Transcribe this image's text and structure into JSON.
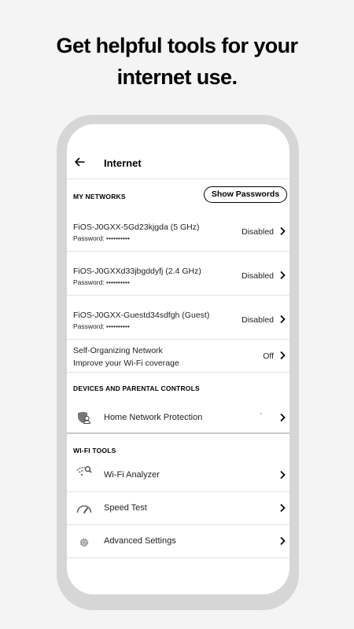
{
  "headline": {
    "line1": "Get helpful tools for your",
    "line2": "internet use."
  },
  "appbar": {
    "title": "Internet",
    "back_icon": "arrow-left-icon"
  },
  "my_networks": {
    "header": "MY NETWORKS",
    "show_passwords_label": "Show Passwords",
    "networks": [
      {
        "name": "FiOS-J0GXX-5Gd23kjgda (5 GHz)",
        "password": "Password: ••••••••••",
        "status": "Disabled"
      },
      {
        "name": "FiOS-J0GXXd33jbgddyfj (2.4 GHz)",
        "password": "Password: ••••••••••",
        "status": "Disabled"
      },
      {
        "name": "FiOS-J0GXX-Guestd34sdfgh (Guest)",
        "password": "Password: ••••••••••",
        "status": "Disabled"
      }
    ],
    "son": {
      "title": "Self-Organizing Network",
      "subtitle": "Improve your Wi-Fi coverage",
      "status": "Off"
    }
  },
  "devices": {
    "header": "DEVICES AND PARENTAL CONTROLS",
    "home_protection": {
      "label": "Home Network Protection",
      "tick": "ˋ",
      "icon": "shield-user-icon"
    }
  },
  "wifi_tools": {
    "header": "WI-FI TOOLS",
    "items": [
      {
        "label": "Wi-Fi Analyzer",
        "icon": "wifi-search-icon"
      },
      {
        "label": "Speed Test",
        "icon": "speedometer-icon"
      },
      {
        "label": "Advanced Settings",
        "icon": "gear-icon"
      }
    ]
  }
}
